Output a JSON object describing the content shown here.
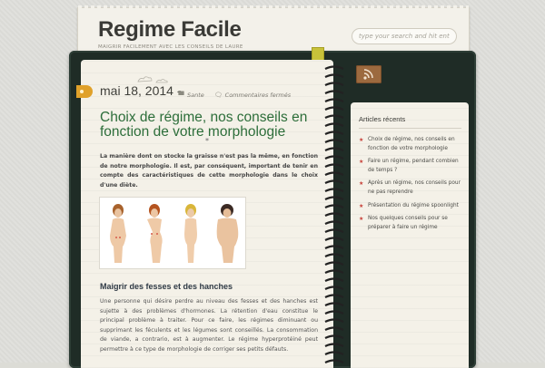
{
  "site": {
    "title": "Regime Facile",
    "tagline": "MAIGRIR FACILEMENT AVEC LES CONSEILS DE LAURE"
  },
  "search": {
    "placeholder": "type your search and hit enter"
  },
  "post": {
    "date": "mai 18, 2014 -",
    "category": "Sante",
    "comments": "Commentaires fermés",
    "title": "Choix de régime, nos conseils en fonction de votre morphologie",
    "separator": "*",
    "intro": "La manière dont on stocke la graisse n'est pas la même, en fonction de notre morphologie. Il est, par conséquent, important de tenir en compte des caractéristiques de cette morphologie dans le choix d'une diète.",
    "subheading": "Maigrir des fesses et des hanches",
    "body": "Une personne qui désire perdre au niveau des fesses et des hanches est sujette à des problèmes d'hormones. La rétention d'eau constitue le principal problème à traiter. Pour ce faire, les régimes diminuant ou supprimant les féculents et les légumes sont conseillés. La consommation de viande, a contrario, est à augmenter. Le régime hyperprotéiné peut permettre à ce type de morphologie de corriger ses petits défauts."
  },
  "sidebar": {
    "widget_title": "Articles récents",
    "recent": [
      "Choix de régime, nos conseils en fonction de votre morphologie",
      "Faire un régime, pendant combien de temps ?",
      "Après un régime, nos conseils pour ne pas reprendre",
      "Présentation du régime spoonlight",
      "Nos quelques conseils pour se préparer à faire un régime"
    ]
  },
  "colors": {
    "binder": "#1f2c26",
    "title_green": "#2d6e3a",
    "date_tab": "#e0a12a",
    "star": "#c8423a"
  }
}
